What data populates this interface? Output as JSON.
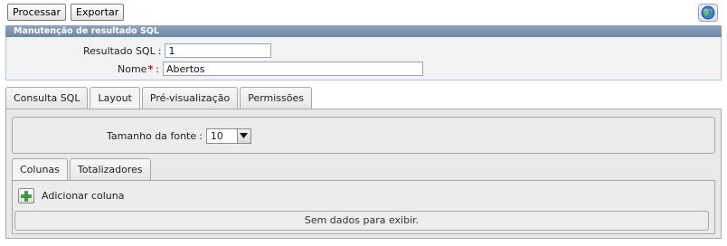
{
  "toolbar": {
    "process_label": "Processar",
    "export_label": "Exportar",
    "help_icon": "globe-help-icon"
  },
  "panel": {
    "title": "Manutenção de resultado SQL",
    "result_label": "Resultado SQL",
    "result_value": "1",
    "name_label": "Nome",
    "name_required": "*",
    "name_value": "Abertos"
  },
  "tabs": [
    {
      "label": "Consulta SQL",
      "active": false
    },
    {
      "label": "Layout",
      "active": true
    },
    {
      "label": "Pré-visualização",
      "active": false
    },
    {
      "label": "Permissões",
      "active": false
    }
  ],
  "layout": {
    "font_size_label": "Tamanho da fonte",
    "font_size_value": "10",
    "subtabs": [
      {
        "label": "Colunas",
        "active": true
      },
      {
        "label": "Totalizadores",
        "active": false
      }
    ],
    "add_column_label": "Adicionar coluna",
    "add_icon": "plus-icon",
    "empty_text": "Sem dados para exibir."
  },
  "colors": {
    "title_bar": "#7b90ae",
    "required": "#dd0000",
    "add_icon": "#3aa53a"
  }
}
